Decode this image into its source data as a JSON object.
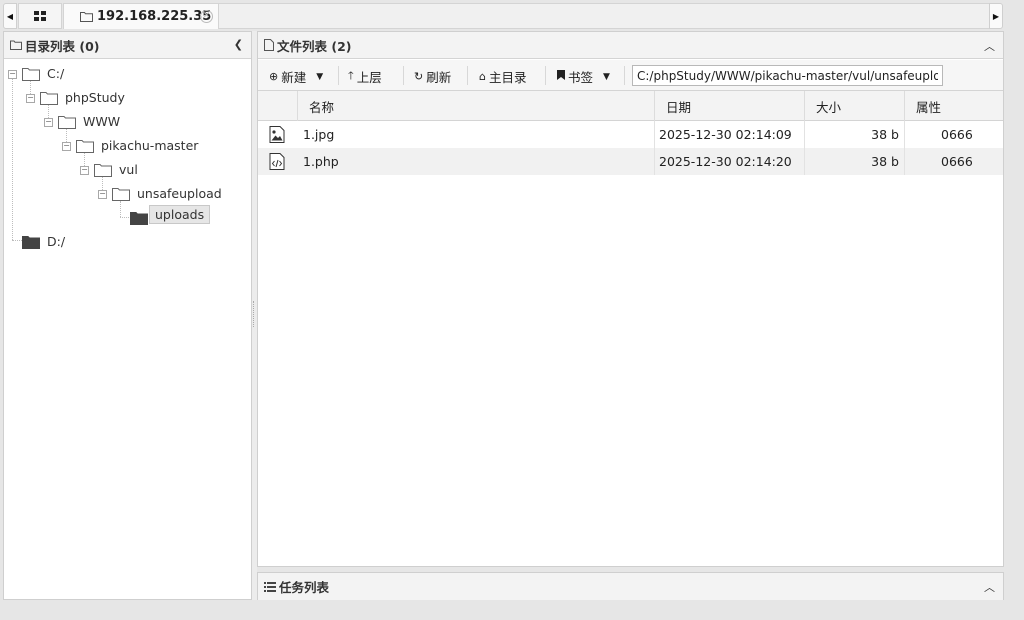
{
  "tabs": {
    "active_title": "192.168.225.35"
  },
  "left_panel": {
    "title": "目录列表 (0)",
    "tree": [
      {
        "label": "C:/"
      },
      {
        "label": "phpStudy"
      },
      {
        "label": "WWW"
      },
      {
        "label": "pikachu-master"
      },
      {
        "label": "vul"
      },
      {
        "label": "unsafeupload"
      },
      {
        "label": "uploads",
        "selected": true
      },
      {
        "label": "D:/"
      }
    ]
  },
  "right_panel": {
    "title": "文件列表 (2)",
    "toolbar": {
      "new_label": "新建",
      "up_label": "上层",
      "refresh_label": "刷新",
      "home_label": "主目录",
      "bookmark_label": "书签",
      "path_value": "C:/phpStudy/WWW/pikachu-master/vul/unsafeupload/uploads/"
    },
    "columns": {
      "name": "名称",
      "date": "日期",
      "size": "大小",
      "attr": "属性"
    },
    "files": [
      {
        "icon": "image-file-icon",
        "name": "1.jpg",
        "date": "2025-12-30 02:14:09",
        "size": "38 b",
        "attr": "0666"
      },
      {
        "icon": "code-file-icon",
        "name": "1.php",
        "date": "2025-12-30 02:14:20",
        "size": "38 b",
        "attr": "0666"
      }
    ]
  },
  "task_panel": {
    "title": "任务列表"
  }
}
